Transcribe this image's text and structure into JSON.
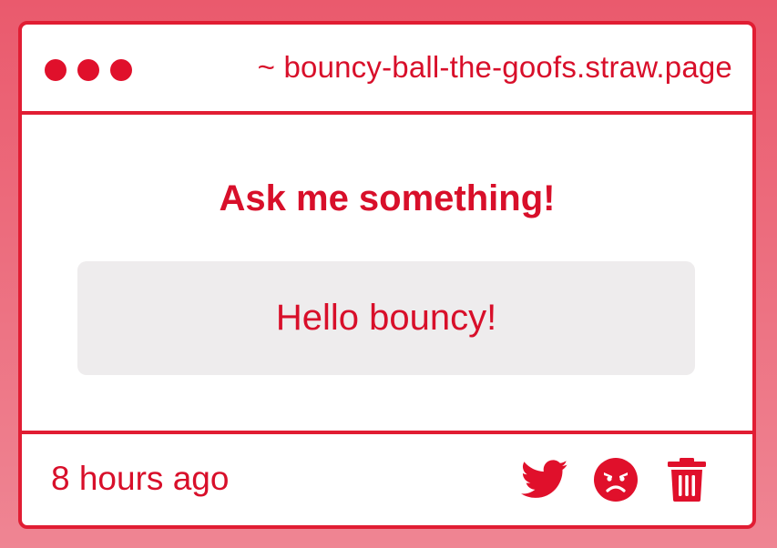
{
  "window": {
    "url": "~ bouncy-ball-the-goofs.straw.page"
  },
  "main": {
    "question": "Ask me something!",
    "answer": "Hello bouncy!"
  },
  "footer": {
    "timestamp": "8 hours ago",
    "icons": [
      "twitter-icon",
      "angry-face-icon",
      "trash-icon"
    ]
  },
  "colors": {
    "accent": "#e0102b",
    "background_top": "#ea5a6d",
    "background_bottom": "#ef8593",
    "answer_box": "#eeeced"
  }
}
